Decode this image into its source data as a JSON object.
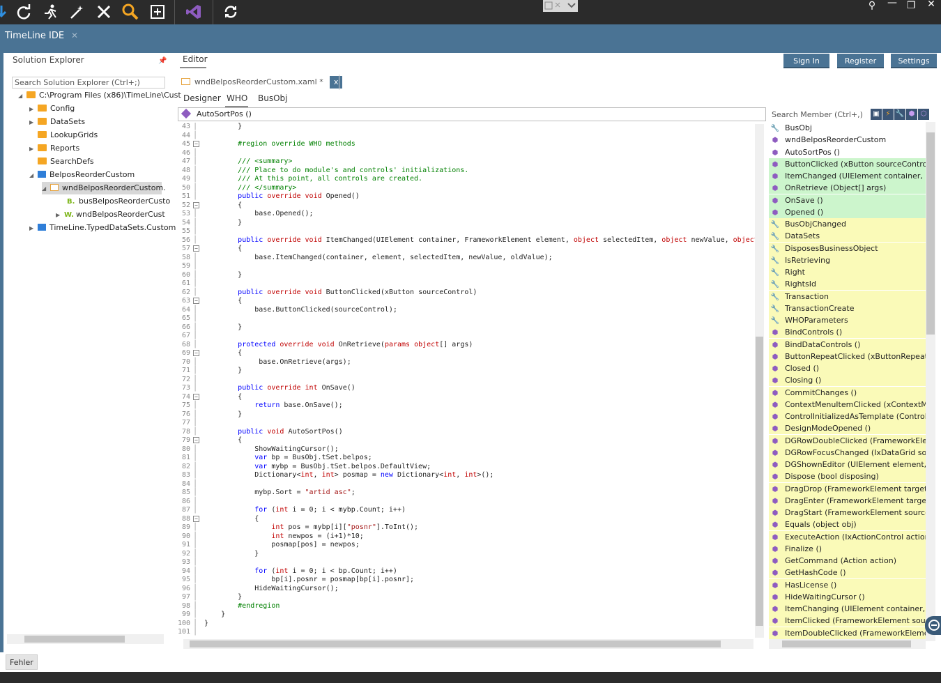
{
  "app": {
    "title": "TimeLine IDE"
  },
  "toolbar": {
    "icons": [
      "arrow-down-icon",
      "refresh-icon",
      "run-icon",
      "magic-wand-icon",
      "tools-icon",
      "search-icon",
      "add-icon",
      "visual-studio-icon",
      "sync-icon"
    ],
    "layout_icon": "layout-icon"
  },
  "window_controls": [
    "pin-icon",
    "minimize-icon",
    "restore-icon",
    "close-icon"
  ],
  "solution_explorer": {
    "title": "Solution Explorer",
    "search_placeholder": "Search Solution Explorer (Ctrl+;)",
    "tree": [
      {
        "label": "C:\\Program Files (x86)\\TimeLine\\Cust",
        "icon": "folder-icon",
        "expanded": true
      },
      {
        "label": "Config",
        "icon": "folder-icon"
      },
      {
        "label": "DataSets",
        "icon": "folder-icon"
      },
      {
        "label": "LookupGrids",
        "icon": "folder-icon"
      },
      {
        "label": "Reports",
        "icon": "folder-icon"
      },
      {
        "label": "SearchDefs",
        "icon": "folder-icon"
      },
      {
        "label": "BelposReorderCustom",
        "icon": "project-icon",
        "expanded": true
      },
      {
        "label": "wndBelposReorderCustom.",
        "icon": "xaml-icon",
        "selected": true
      },
      {
        "label": "busBelposReorderCusto",
        "icon": "business-object-icon"
      },
      {
        "label": "wndBelposReorderCust",
        "icon": "window-code-icon"
      },
      {
        "label": "TimeLine.TypedDataSets.Custom",
        "icon": "project-icon"
      }
    ]
  },
  "editor": {
    "label": "Editor",
    "file_tab": {
      "name": "wndBelposReorderCustom.xaml",
      "modified": "*",
      "close": "x"
    },
    "sub_tabs": [
      "Designer",
      "WHO",
      "BusObj"
    ],
    "active_sub_tab": "WHO",
    "member_combo": "AutoSortPos ()"
  },
  "header_buttons": {
    "sign_in": "Sign In",
    "register": "Register",
    "settings": "Settings"
  },
  "code_lines": [
    {
      "n": "43",
      "t": "        }"
    },
    {
      "n": "44",
      "t": ""
    },
    {
      "n": "45",
      "t": "        #region override WHO methods",
      "fold": true
    },
    {
      "n": "46",
      "t": ""
    },
    {
      "n": "47",
      "t": "        /// <summary>"
    },
    {
      "n": "48",
      "t": "        /// Place to do module's and controls' initializations."
    },
    {
      "n": "49",
      "t": "        /// At this point, all controls are created."
    },
    {
      "n": "50",
      "t": "        /// </summary>"
    },
    {
      "n": "51",
      "t": "        public override void Opened()"
    },
    {
      "n": "52",
      "t": "        {",
      "fold": true
    },
    {
      "n": "53",
      "t": "            base.Opened();"
    },
    {
      "n": "54",
      "t": "        }"
    },
    {
      "n": "55",
      "t": ""
    },
    {
      "n": "56",
      "t": "        public override void ItemChanged(UIElement container, FrameworkElement element, object selectedItem, object newValue, object oldV"
    },
    {
      "n": "57",
      "t": "        {",
      "fold": true
    },
    {
      "n": "58",
      "t": "            base.ItemChanged(container, element, selectedItem, newValue, oldValue);"
    },
    {
      "n": "59",
      "t": ""
    },
    {
      "n": "60",
      "t": "        }"
    },
    {
      "n": "61",
      "t": ""
    },
    {
      "n": "62",
      "t": "        public override void ButtonClicked(xButton sourceControl)"
    },
    {
      "n": "63",
      "t": "        {",
      "fold": true
    },
    {
      "n": "64",
      "t": "            base.ButtonClicked(sourceControl);"
    },
    {
      "n": "65",
      "t": ""
    },
    {
      "n": "66",
      "t": "        }"
    },
    {
      "n": "67",
      "t": ""
    },
    {
      "n": "68",
      "t": "        protected override void OnRetrieve(params object[] args)"
    },
    {
      "n": "69",
      "t": "        {",
      "fold": true
    },
    {
      "n": "70",
      "t": "             base.OnRetrieve(args);"
    },
    {
      "n": "71",
      "t": "        }"
    },
    {
      "n": "72",
      "t": ""
    },
    {
      "n": "73",
      "t": "        public override int OnSave()"
    },
    {
      "n": "74",
      "t": "        {",
      "fold": true
    },
    {
      "n": "75",
      "t": "            return base.OnSave();"
    },
    {
      "n": "76",
      "t": "        }"
    },
    {
      "n": "77",
      "t": ""
    },
    {
      "n": "78",
      "t": "        public void AutoSortPos()"
    },
    {
      "n": "79",
      "t": "        {",
      "fold": true
    },
    {
      "n": "80",
      "t": "            ShowWaitingCursor();"
    },
    {
      "n": "81",
      "t": "            var bp = BusObj.tSet.belpos;"
    },
    {
      "n": "82",
      "t": "            var mybp = BusObj.tSet.belpos.DefaultView;"
    },
    {
      "n": "83",
      "t": "            Dictionary<int, int> posmap = new Dictionary<int, int>();"
    },
    {
      "n": "84",
      "t": ""
    },
    {
      "n": "85",
      "t": "            mybp.Sort = \"artid asc\";"
    },
    {
      "n": "86",
      "t": ""
    },
    {
      "n": "87",
      "t": "            for (int i = 0; i < mybp.Count; i++)"
    },
    {
      "n": "88",
      "t": "            {",
      "fold": true
    },
    {
      "n": "89",
      "t": "                int pos = mybp[i][\"posnr\"].ToInt();"
    },
    {
      "n": "90",
      "t": "                int newpos = (i+1)*10;"
    },
    {
      "n": "91",
      "t": "                posmap[pos] = newpos;"
    },
    {
      "n": "92",
      "t": "            }"
    },
    {
      "n": "93",
      "t": ""
    },
    {
      "n": "94",
      "t": "            for (int i = 0; i < bp.Count; i++)"
    },
    {
      "n": "95",
      "t": "                bp[i].posnr = posmap[bp[i].posnr];"
    },
    {
      "n": "96",
      "t": "            HideWaitingCursor();"
    },
    {
      "n": "97",
      "t": "        }"
    },
    {
      "n": "98",
      "t": "        #endregion"
    },
    {
      "n": "99",
      "t": "    }"
    },
    {
      "n": "100",
      "t": "}"
    },
    {
      "n": "101",
      "t": ""
    }
  ],
  "member_panel": {
    "search_placeholder": "Search Member (Ctrl+,)",
    "filter_icons": [
      "class-filter-icon",
      "event-filter-icon",
      "property-filter-icon",
      "method-filter-icon",
      "member-filter-icon"
    ],
    "items": [
      {
        "label": "BusObj",
        "icon": "property-icon",
        "bg": ""
      },
      {
        "label": "wndBelposReorderCustom",
        "icon": "class-icon",
        "bg": ""
      },
      {
        "label": "AutoSortPos ()",
        "icon": "method-icon",
        "bg": ""
      },
      {
        "label": "ButtonClicked (xButton sourceControl)",
        "icon": "method-icon",
        "bg": "green"
      },
      {
        "label": "ItemChanged (UIElement container, Fram",
        "icon": "method-icon",
        "bg": "green"
      },
      {
        "label": "OnRetrieve (Object[] args)",
        "icon": "method-icon",
        "bg": "green"
      },
      {
        "label": "OnSave ()",
        "icon": "method-icon",
        "bg": "green"
      },
      {
        "label": "Opened ()",
        "icon": "method-icon",
        "bg": "green"
      },
      {
        "label": "BusObjChanged",
        "icon": "property-icon",
        "bg": "yellow"
      },
      {
        "label": "DataSets",
        "icon": "property-icon",
        "bg": "yellow"
      },
      {
        "label": "DisposesBusinessObject",
        "icon": "property-icon",
        "bg": "yellow"
      },
      {
        "label": "IsRetrieving",
        "icon": "property-icon",
        "bg": "yellow"
      },
      {
        "label": "Right",
        "icon": "property-icon",
        "bg": "yellow"
      },
      {
        "label": "RightsId",
        "icon": "property-icon",
        "bg": "yellow"
      },
      {
        "label": "Transaction",
        "icon": "property-icon",
        "bg": "yellow"
      },
      {
        "label": "TransactionCreate",
        "icon": "property-icon",
        "bg": "yellow"
      },
      {
        "label": "WHOParameters",
        "icon": "property-icon",
        "bg": "yellow"
      },
      {
        "label": "BindControls ()",
        "icon": "method-icon",
        "bg": "yellow"
      },
      {
        "label": "BindDataControls ()",
        "icon": "method-icon",
        "bg": "yellow"
      },
      {
        "label": "ButtonRepeatClicked (xButtonRepeat so",
        "icon": "method-icon",
        "bg": "yellow"
      },
      {
        "label": "Closed ()",
        "icon": "method-icon",
        "bg": "yellow"
      },
      {
        "label": "Closing ()",
        "icon": "method-icon",
        "bg": "yellow"
      },
      {
        "label": "CommitChanges ()",
        "icon": "method-icon",
        "bg": "yellow"
      },
      {
        "label": "ContextMenuItemClicked (xContextMenu",
        "icon": "method-icon",
        "bg": "yellow"
      },
      {
        "label": "ControlInitializedAsTemplate (Control sou",
        "icon": "method-icon",
        "bg": "yellow"
      },
      {
        "label": "DesignModeOpened ()",
        "icon": "method-icon",
        "bg": "yellow"
      },
      {
        "label": "DGRowDoubleClicked (FrameworkElemen",
        "icon": "method-icon",
        "bg": "yellow"
      },
      {
        "label": "DGRowFocusChanged (IxDataGrid sourc",
        "icon": "method-icon",
        "bg": "yellow"
      },
      {
        "label": "DGShownEditor (UIElement element, UIE",
        "icon": "method-icon",
        "bg": "yellow"
      },
      {
        "label": "Dispose (bool disposing)",
        "icon": "method-icon",
        "bg": "yellow"
      },
      {
        "label": "DragDrop (FrameworkElement target, obj",
        "icon": "method-icon",
        "bg": "yellow"
      },
      {
        "label": "DragEnter (FrameworkElement target, ob",
        "icon": "method-icon",
        "bg": "yellow"
      },
      {
        "label": "DragStart (FrameworkElement source)",
        "icon": "method-icon",
        "bg": "yellow"
      },
      {
        "label": "Equals (object obj)",
        "icon": "method-icon",
        "bg": "yellow"
      },
      {
        "label": "ExecuteAction (IxActionControl actionCo",
        "icon": "method-icon",
        "bg": "yellow"
      },
      {
        "label": "Finalize ()",
        "icon": "method-icon",
        "bg": "yellow"
      },
      {
        "label": "GetCommand (Action action)",
        "icon": "method-icon",
        "bg": "yellow"
      },
      {
        "label": "GetHashCode ()",
        "icon": "method-icon",
        "bg": "yellow"
      },
      {
        "label": "HasLicense ()",
        "icon": "method-icon",
        "bg": "yellow"
      },
      {
        "label": "HideWaitingCursor ()",
        "icon": "method-icon",
        "bg": "yellow"
      },
      {
        "label": "ItemChanging (UIElement container, Fran",
        "icon": "method-icon",
        "bg": "yellow"
      },
      {
        "label": "ItemClicked (FrameworkElement source",
        "icon": "method-icon",
        "bg": "yellow"
      },
      {
        "label": "ItemDoubleClicked (FrameworkElement",
        "icon": "method-icon",
        "bg": "yellow"
      }
    ]
  },
  "bottom": {
    "error_tab": "Fehler"
  },
  "colors": {
    "accent": "#4a7394",
    "toolbar_bg": "#2b2b2b",
    "highlight_green": "#ccf5cc",
    "highlight_yellow": "#fafab8",
    "keyword": "#0000ff",
    "comment": "#008000"
  }
}
